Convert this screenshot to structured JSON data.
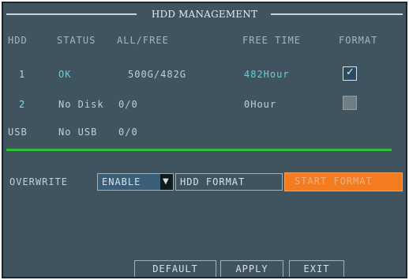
{
  "window": {
    "title": "HDD MANAGEMENT"
  },
  "table": {
    "headers": {
      "hdd": "HDD",
      "status": "STATUS",
      "all_free": "ALL/FREE",
      "free_time": "FREE TIME",
      "format": "FORMAT"
    },
    "rows": [
      {
        "hdd": "1",
        "status": "OK",
        "all_free": "500G/482G",
        "free_time": "482Hour",
        "format_checked": true
      },
      {
        "hdd": "2",
        "status": "No Disk",
        "all_free": "0/0",
        "free_time": "0Hour",
        "format_checked": false
      },
      {
        "hdd": "USB",
        "status": "No USB",
        "all_free": "0/0",
        "free_time": "",
        "format_checked": false
      }
    ]
  },
  "overwrite": {
    "label": "OVERWRITE",
    "value": "ENABLE"
  },
  "buttons": {
    "hdd_format": "HDD FORMAT",
    "start_format": "START FORMAT",
    "default": "DEFAULT",
    "apply": "APPLY",
    "exit": "EXIT"
  },
  "icons": {
    "checkbox_checked": "check-icon",
    "dropdown": "triangle-down-icon"
  },
  "colors": {
    "background": "#3f545e",
    "separator": "#2fbf3c",
    "accent": "#f47b1f",
    "status_ok": "#58d6e0"
  }
}
